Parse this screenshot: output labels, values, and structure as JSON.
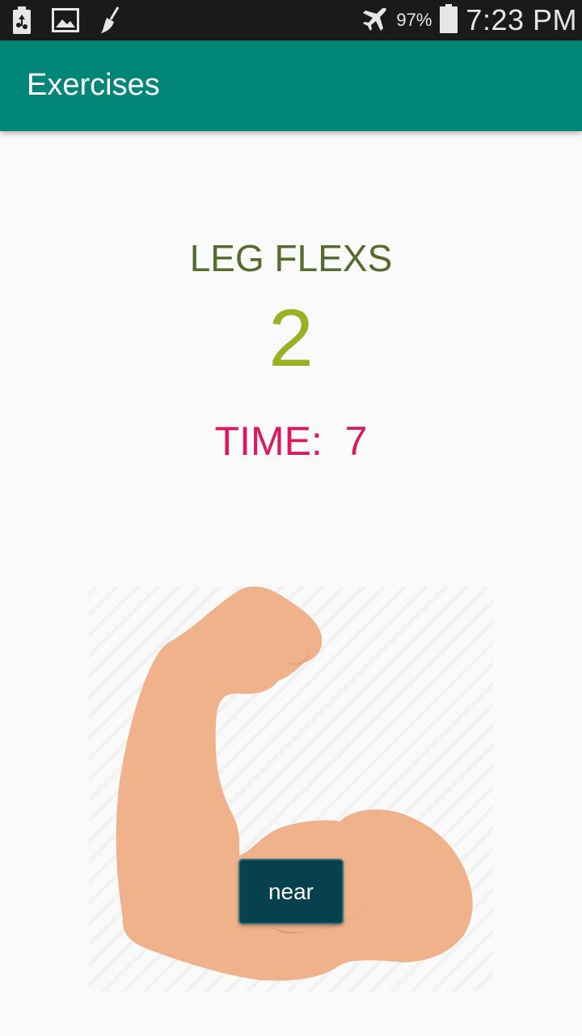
{
  "status_bar": {
    "icons_left": [
      "battery-saver-icon",
      "image-icon",
      "broom-icon"
    ],
    "airplane_icon": "airplane-icon",
    "battery_percent": "97%",
    "battery_icon": "battery-icon",
    "time": "7:23 PM"
  },
  "app_bar": {
    "title": "Exercises"
  },
  "exercise": {
    "name": "LEG FLEXS",
    "count": "2",
    "timer_label": "TIME:",
    "timer_value": "7",
    "image": "flexed-arm-illustration"
  },
  "actions": {
    "near_label": "near"
  },
  "colors": {
    "app_bar": "#008577",
    "exercise_name": "#556b2f",
    "count": "#9ab125",
    "timer": "#d81b60",
    "button": "#08414e",
    "skin": "#f0b28a"
  }
}
